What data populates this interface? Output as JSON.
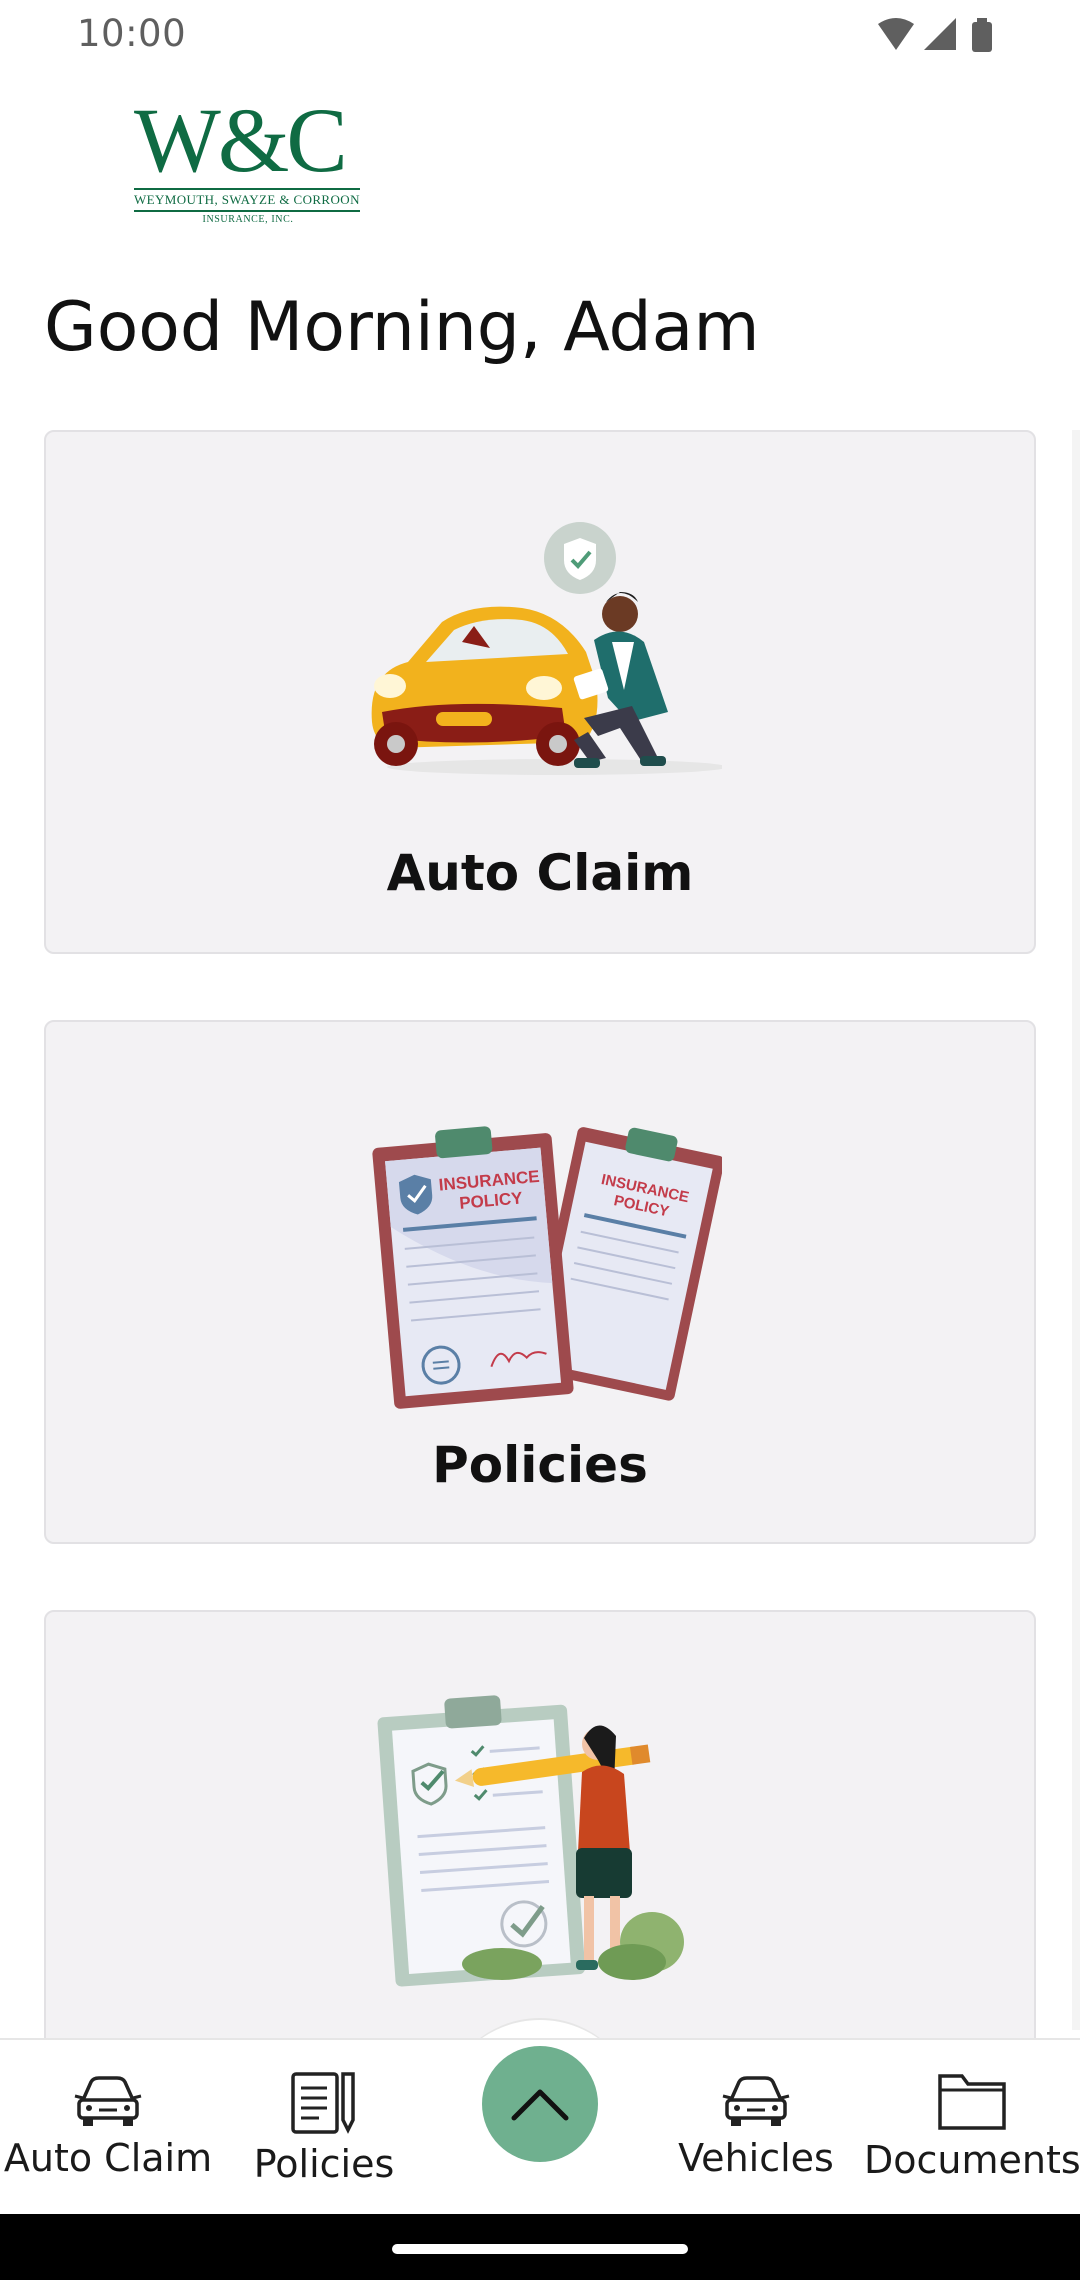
{
  "status_bar": {
    "time": "10:00"
  },
  "logo": {
    "mark": "W&C",
    "line1": "WEYMOUTH, SWAYZE & CORROON",
    "line2": "INSURANCE, INC."
  },
  "greeting": "Good Morning, Adam",
  "cards": [
    {
      "label": "Auto Claim",
      "illustration": "car-damage-inspection-illustration"
    },
    {
      "label": "Policies",
      "illustration": "insurance-policy-clipboards-illustration",
      "doc_title_line1": "INSURANCE",
      "doc_title_line2": "POLICY"
    },
    {
      "label": "",
      "illustration": "checklist-with-person-illustration"
    }
  ],
  "bottom_nav": {
    "items": [
      {
        "label": "Auto Claim",
        "icon": "car-icon"
      },
      {
        "label": "Policies",
        "icon": "document-pen-icon"
      },
      {
        "label": "Vehicles",
        "icon": "car-icon"
      },
      {
        "label": "Documents",
        "icon": "folder-icon"
      }
    ],
    "fab_icon": "chevron-up-icon"
  },
  "colors": {
    "brand_green": "#0f6b43",
    "fab_green": "#6fb08f",
    "card_bg": "#f3f2f4"
  }
}
